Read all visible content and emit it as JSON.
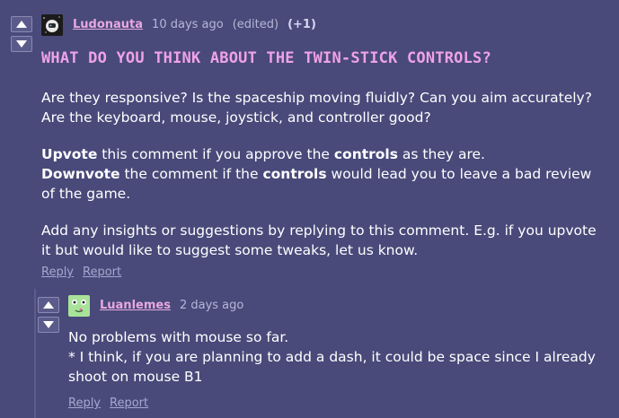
{
  "colors": {
    "background": "#494a7a",
    "author": "#e8a8e0",
    "title": "#f0a2e6",
    "muted": "#b5b6d6",
    "links": "#a6a7cf"
  },
  "comment": {
    "author": "Ludonauta",
    "time": "10 days ago",
    "edited": "(edited)",
    "score": "(+1)",
    "avatar_icon": "astronaut-avatar-icon",
    "title": "WHAT DO YOU THINK ABOUT THE TWIN-STICK CONTROLS?",
    "para1": "Are they responsive? Is the spaceship moving fluidly? Can you aim accurately? Are the keyboard, mouse, joystick, and controller good?",
    "para2_line1": {
      "bold1": "Upvote",
      "text1": " this comment if you approve the ",
      "bold2": "controls",
      "text2": " as they are."
    },
    "para2_line2": {
      "bold1": "Downvote",
      "text1": " the comment if the ",
      "bold2": "controls",
      "text2": " would lead you to leave a bad review of the game."
    },
    "para3": "Add any insights or suggestions by replying to this comment. E.g. if you upvote it but would like to suggest some tweaks, let us know.",
    "reply_label": "Reply",
    "report_label": "Report"
  },
  "reply": {
    "author": "Luanlemes",
    "time": "2 days ago",
    "avatar_icon": "green-frog-avatar-icon",
    "line1": "No problems with mouse so far.",
    "line2": "* I think, if you are planning to add a dash, it could be space since I already shoot on mouse B1",
    "reply_label": "Reply",
    "report_label": "Report"
  }
}
